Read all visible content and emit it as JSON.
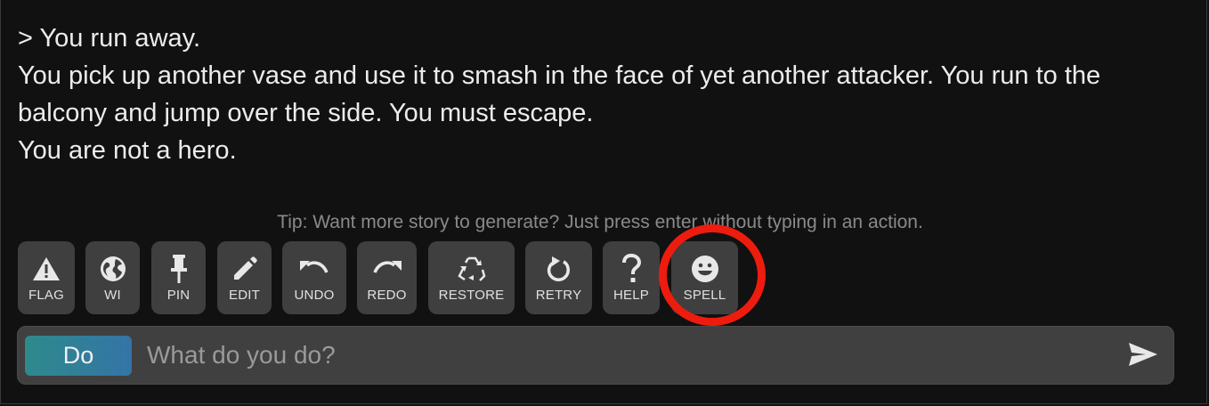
{
  "story": {
    "lines": [
      "> You run away.",
      "You pick up another vase and use it to smash in the face of yet another attacker. You run to the balcony and jump over the side. You must escape.",
      "You are not a hero."
    ]
  },
  "tip": "Tip: Want more story to generate? Just press enter without typing in an action.",
  "toolbar": {
    "buttons": [
      {
        "label": "FLAG",
        "icon": "warning-icon"
      },
      {
        "label": "WI",
        "icon": "globe-icon"
      },
      {
        "label": "PIN",
        "icon": "pin-icon"
      },
      {
        "label": "EDIT",
        "icon": "pencil-icon"
      },
      {
        "label": "UNDO",
        "icon": "undo-icon"
      },
      {
        "label": "REDO",
        "icon": "redo-icon"
      },
      {
        "label": "RESTORE",
        "icon": "recycle-icon"
      },
      {
        "label": "RETRY",
        "icon": "retry-icon"
      },
      {
        "label": "HELP",
        "icon": "question-icon"
      },
      {
        "label": "SPELL",
        "icon": "smiley-icon"
      }
    ]
  },
  "input": {
    "mode_label": "Do",
    "placeholder": "What do you do?",
    "value": ""
  },
  "colors": {
    "background": "#111111",
    "button_bg": "#3f3f3f",
    "highlight_ring": "#ee1c0e",
    "mode_gradient_start": "#2e8a8c",
    "mode_gradient_end": "#3474a6"
  }
}
